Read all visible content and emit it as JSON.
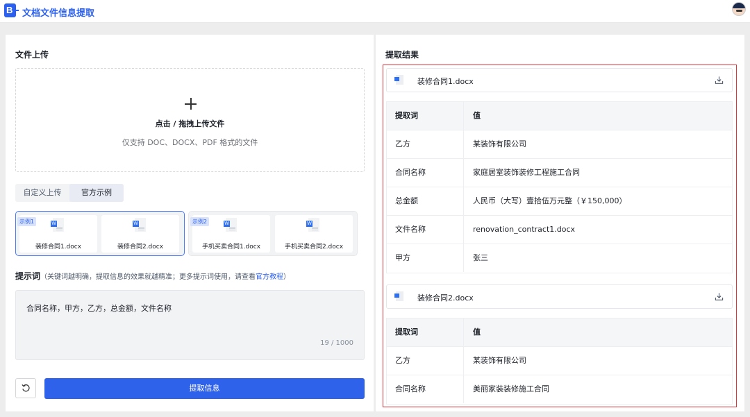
{
  "app": {
    "title": "文档文件信息提取",
    "logo_text": "B"
  },
  "upload": {
    "title": "文件上传",
    "drop_main": "点击 / 拖拽上传文件",
    "drop_hint": "仅支持 DOC、DOCX、PDF 格式的文件"
  },
  "tabs": [
    {
      "label": "自定义上传"
    },
    {
      "label": "官方示例"
    }
  ],
  "examples": [
    {
      "badge": "示例1",
      "files": [
        {
          "name": "装修合同1.docx"
        },
        {
          "name": "装修合同2.docx"
        }
      ]
    },
    {
      "badge": "示例2",
      "files": [
        {
          "name": "手机买卖合同1.docx"
        },
        {
          "name": "手机买卖合同2.docx"
        }
      ]
    }
  ],
  "prompt": {
    "title": "提示词",
    "hint_before": "（关键词越明确，提取信息的效果就越精准；更多提示词使用，请查看",
    "hint_link": "官方教程",
    "hint_after": "）",
    "value": "合同名称，甲方，乙方，总金额，文件名称",
    "counter": "19 / 1000"
  },
  "actions": {
    "extract_label": "提取信息",
    "reset_icon": "reset-icon"
  },
  "results": {
    "title": "提取结果",
    "header_key": "提取词",
    "header_value": "值",
    "files": [
      {
        "name": "装修合同1.docx",
        "rows": [
          {
            "k": "乙方",
            "v": "某装饰有限公司"
          },
          {
            "k": "合同名称",
            "v": "家庭居室装饰装修工程施工合同"
          },
          {
            "k": "总金额",
            "v": "人民币（大写）壹拾伍万元整（￥150,000）"
          },
          {
            "k": "文件名称",
            "v": "renovation_contract1.docx"
          },
          {
            "k": "甲方",
            "v": "张三"
          }
        ]
      },
      {
        "name": "装修合同2.docx",
        "rows": [
          {
            "k": "乙方",
            "v": "某装饰有限公司"
          },
          {
            "k": "合同名称",
            "v": "美丽家装装修施工合同"
          }
        ]
      }
    ]
  },
  "colors": {
    "accent": "#2f62ea",
    "highlight_border": "#e0333a"
  }
}
